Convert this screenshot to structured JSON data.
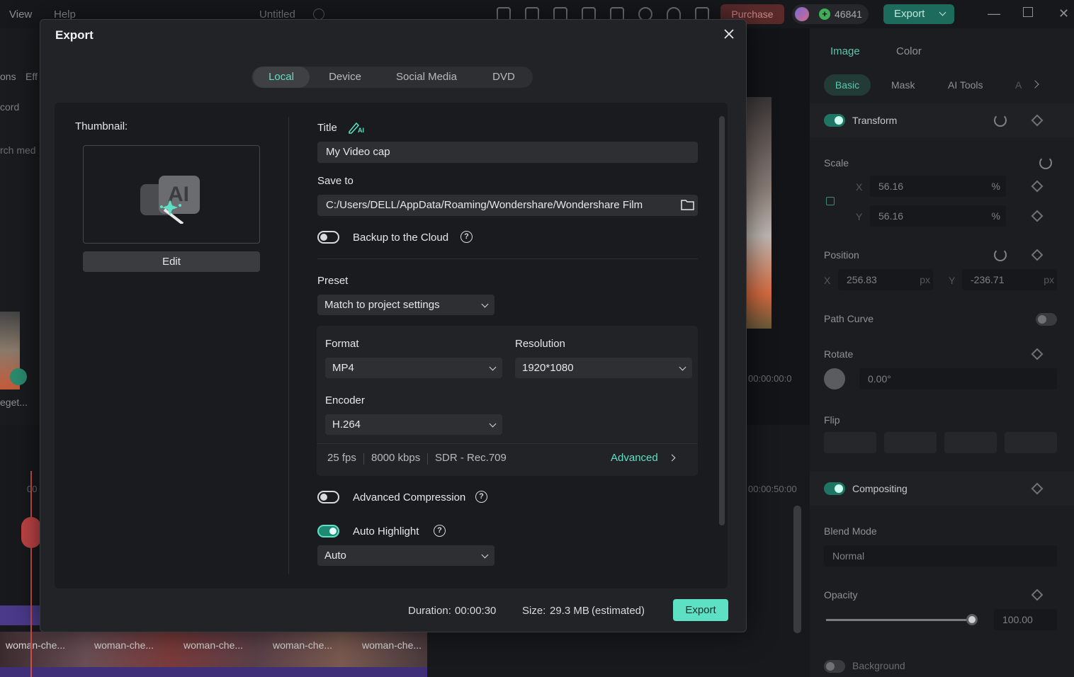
{
  "app": {
    "menu": [
      "View",
      "Help"
    ],
    "project_title": "Untitled",
    "purchase_label": "Purchase",
    "credits": "46841",
    "export_label": "Export",
    "left_panel_fragments": [
      "ons",
      "Eff",
      "cord",
      "rch med",
      "eget..."
    ],
    "timecodes": [
      "00:00:00:0",
      "00:00:50:00",
      "00"
    ]
  },
  "right_panel": {
    "tabs": [
      "Image",
      "Color"
    ],
    "subtabs": [
      "Basic",
      "Mask",
      "AI Tools",
      "A"
    ],
    "transform_label": "Transform",
    "scale_label": "Scale",
    "scale_x_axis": "X",
    "scale_y_axis": "Y",
    "scale_x": "56.16",
    "scale_y": "56.16",
    "scale_unit": "%",
    "position_label": "Position",
    "pos_x_axis": "X",
    "pos_y_axis": "Y",
    "pos_x": "256.83",
    "pos_y": "-236.71",
    "pos_unit": "px",
    "path_curve_label": "Path Curve",
    "rotate_label": "Rotate",
    "rotate_value": "0.00°",
    "flip_label": "Flip",
    "compositing_label": "Compositing",
    "blend_mode_label": "Blend Mode",
    "blend_mode_value": "Normal",
    "opacity_label": "Opacity",
    "opacity_value": "100.00",
    "background_label": "Background"
  },
  "timeline": {
    "clips": [
      "woman-che...",
      "woman-che...",
      "woman-che...",
      "woman-che...",
      "woman-che..."
    ]
  },
  "dialog": {
    "title": "Export",
    "tabs": [
      "Local",
      "Device",
      "Social Media",
      "DVD"
    ],
    "active_tab": "Local",
    "thumbnail_label": "Thumbnail:",
    "edit_label": "Edit",
    "title_label": "Title",
    "title_value": "My Video cap",
    "save_to_label": "Save to",
    "save_to_value": "C:/Users/DELL/AppData/Roaming/Wondershare/Wondershare Film",
    "backup_label": "Backup to the Cloud",
    "backup_enabled": false,
    "preset_label": "Preset",
    "preset_value": "Match to project settings",
    "format_label": "Format",
    "format_value": "MP4",
    "resolution_label": "Resolution",
    "resolution_value": "1920*1080",
    "encoder_label": "Encoder",
    "encoder_value": "H.264",
    "fps": "25 fps",
    "bitrate": "8000 kbps",
    "color_space": "SDR - Rec.709",
    "advanced_label": "Advanced",
    "adv_compression_label": "Advanced Compression",
    "adv_compression_enabled": false,
    "auto_highlight_label": "Auto Highlight",
    "auto_highlight_enabled": true,
    "auto_highlight_mode": "Auto",
    "duration_label": "Duration:",
    "duration_value": "00:00:30",
    "size_label": "Size:",
    "size_value": "29.3 MB",
    "size_note": "(estimated)",
    "export_label": "Export"
  },
  "colors": {
    "accent": "#5ee0c4",
    "dialog_bg": "#222327",
    "content_bg": "#1a1b1e"
  }
}
